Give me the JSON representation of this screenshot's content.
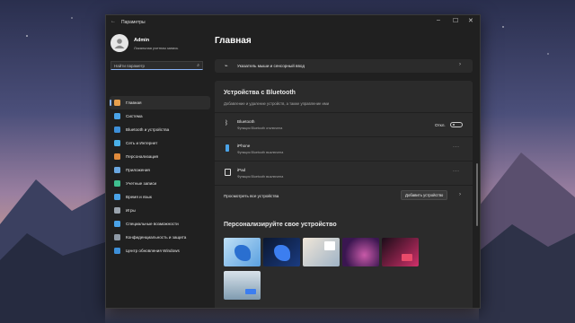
{
  "window": {
    "title": "Параметры",
    "back": "←",
    "controls": [
      "–",
      "☐",
      "✕"
    ]
  },
  "user": {
    "name": "Admin",
    "role": "Локальная учетная запись"
  },
  "search": {
    "placeholder": "Найти параметр",
    "icon": "search-icon"
  },
  "sidebar": {
    "items": [
      {
        "label": "Главная",
        "icon": "home-icon",
        "color": "#e8a04d",
        "active": true
      },
      {
        "label": "Система",
        "icon": "system-icon",
        "color": "#4aa3e8"
      },
      {
        "label": "Bluetooth и устройства",
        "icon": "bluetooth-devices-icon",
        "color": "#3d8fd8"
      },
      {
        "label": "Сеть и Интернет",
        "icon": "network-icon",
        "color": "#4ab0e8"
      },
      {
        "label": "Персонализация",
        "icon": "brush-icon",
        "color": "#e08a3c"
      },
      {
        "label": "Приложения",
        "icon": "apps-icon",
        "color": "#6aa7e0"
      },
      {
        "label": "Учетные записи",
        "icon": "accounts-icon",
        "color": "#3fbf8f"
      },
      {
        "label": "Время и язык",
        "icon": "time-language-icon",
        "color": "#4aa3e8"
      },
      {
        "label": "Игры",
        "icon": "gaming-icon",
        "color": "#9aa3ad"
      },
      {
        "label": "Специальные возможности",
        "icon": "accessibility-icon",
        "color": "#4aa3e8"
      },
      {
        "label": "Конфиденциальность и защита",
        "icon": "shield-icon",
        "color": "#8f9aa6"
      },
      {
        "label": "Центр обновления Windows",
        "icon": "update-icon",
        "color": "#3d8fd8"
      }
    ]
  },
  "main": {
    "title": "Главная",
    "mouse_row": {
      "label": "Указатель мыши и сенсорный ввод",
      "icon": "pointer-icon"
    },
    "bluetooth": {
      "title": "Устройства с Bluetooth",
      "subtitle": "Добавление и удаление устройств, а также управление ими",
      "devices": [
        {
          "name": "Bluetooth",
          "status": "Функция Bluetooth отключена",
          "icon": "bluetooth-icon",
          "control": "Откл."
        },
        {
          "name": "iPhone",
          "status": "Функция Bluetooth выключена",
          "icon": "phone-icon",
          "control": "···"
        },
        {
          "name": "iPad",
          "status": "Функция Bluetooth выключена",
          "icon": "tablet-icon",
          "control": "···"
        }
      ],
      "view_all": "Просмотреть все устройства",
      "add_button": "Добавить устройство"
    },
    "personalize": {
      "title": "Персонализируйте свое устройство",
      "themes": [
        "theme-bloom-light",
        "theme-bloom-dark",
        "theme-glow-fabric",
        "theme-captured-motion",
        "theme-flow",
        "theme-sunrise"
      ]
    }
  }
}
